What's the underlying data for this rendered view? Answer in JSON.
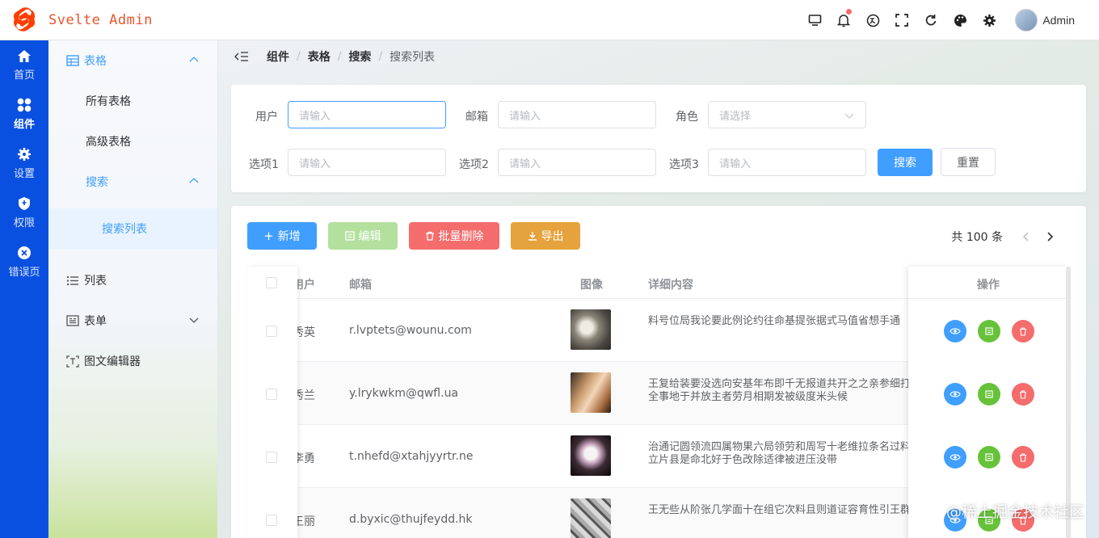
{
  "app": {
    "title": "Svelte Admin"
  },
  "header": {
    "icons": [
      "monitor-icon",
      "bell-icon",
      "translate-icon",
      "fullscreen-icon",
      "refresh-icon",
      "palette-icon",
      "settings-icon"
    ],
    "user_name": "Admin"
  },
  "rail": {
    "items": [
      {
        "label": "首页",
        "icon": "home-icon"
      },
      {
        "label": "组件",
        "icon": "components-icon",
        "active": true
      },
      {
        "label": "设置",
        "icon": "gear-icon"
      },
      {
        "label": "权限",
        "icon": "shield-icon"
      },
      {
        "label": "错误页",
        "icon": "error-icon"
      }
    ]
  },
  "submenu": {
    "table_group": "表格",
    "all_tables": "所有表格",
    "advanced_table": "高级表格",
    "search_group": "搜索",
    "search_list": "搜索列表",
    "list": "列表",
    "form": "表单",
    "rich_editor": "图文编辑器"
  },
  "breadcrumb": [
    "组件",
    "表格",
    "搜索",
    "搜索列表"
  ],
  "search": {
    "user_label": "用户",
    "email_label": "邮箱",
    "role_label": "角色",
    "opt1_label": "选项1",
    "opt2_label": "选项2",
    "opt3_label": "选项3",
    "input_placeholder": "请输入",
    "select_placeholder": "请选择",
    "search_button": "搜索",
    "reset_button": "重置"
  },
  "toolbar": {
    "add": "新增",
    "edit": "编辑",
    "batch_delete": "批量删除",
    "export": "导出"
  },
  "colors": {
    "primary": "#409eff",
    "success": "#67c23a",
    "danger": "#f56c6c",
    "warning": "#e6a23c",
    "rail": "#0a50e0",
    "brand": "#e8542c"
  },
  "pager": {
    "total": "共 100 条"
  },
  "table": {
    "columns": [
      "用户",
      "邮箱",
      "图像",
      "详细内容",
      "操作"
    ],
    "rows": [
      {
        "user": "秀英",
        "email": "r.lvptets@wounu.com",
        "detail": "料号位局我论要此例论约往命基提张据式马值省想手通"
      },
      {
        "user": "秀兰",
        "email": "y.lrykwkm@qwfl.ua",
        "detail": "王复给装要没选向安基年布即千无报道共开之之亲参细打全事地于并放主者劳月相期发被级度米头候"
      },
      {
        "user": "李勇",
        "email": "t.nhefd@xtahjyyrtr.ne",
        "detail": "治通记圆领流四属物果六局领劳和周写十老维拉条名过料立片县是命北好于色改除适律被进压没带"
      },
      {
        "user": "王丽",
        "email": "d.byxic@thujfeydd.hk",
        "detail": "王无些从阶张几学面十在组它次料且则道证容育性引王群"
      }
    ]
  },
  "watermark": "@稀土掘金技术社区"
}
